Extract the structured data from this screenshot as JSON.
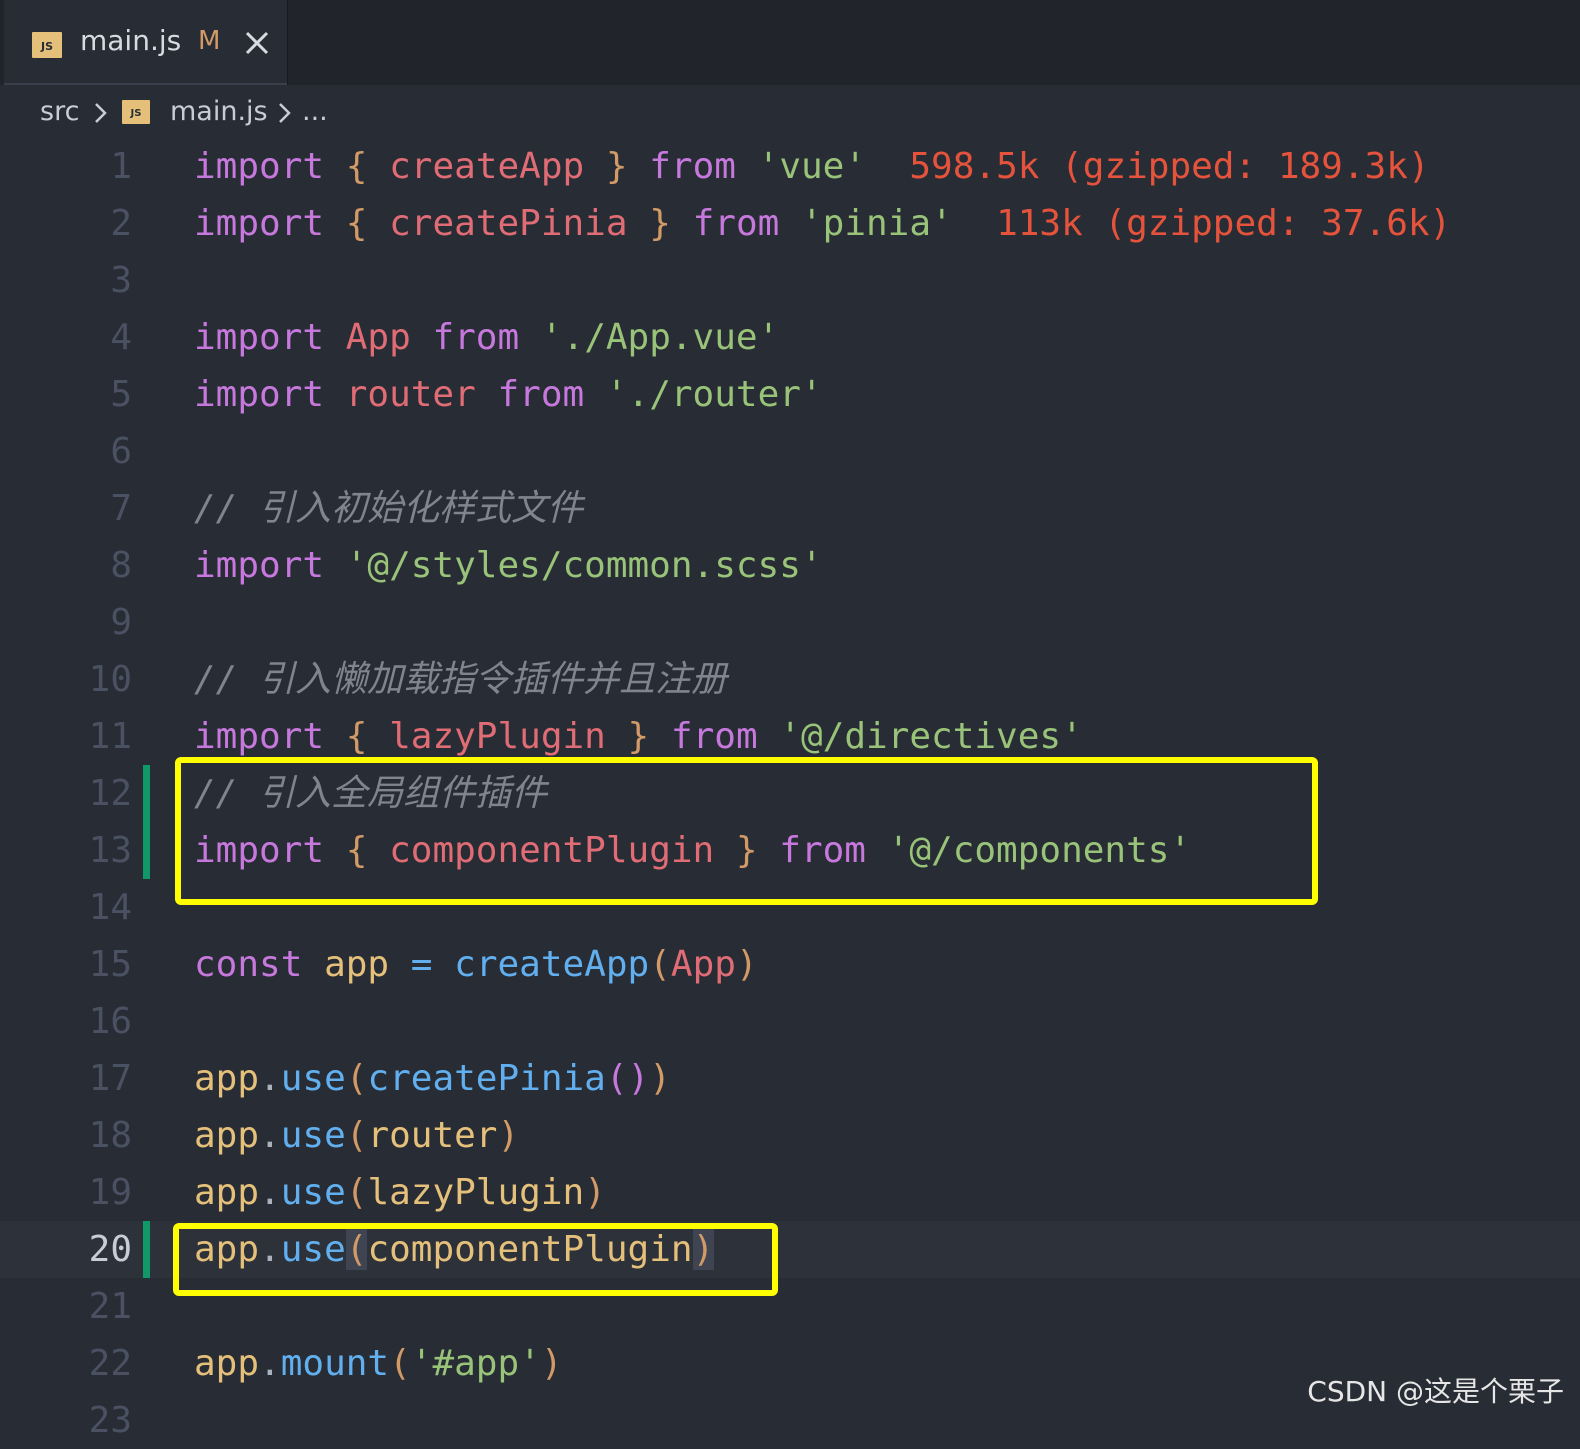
{
  "tab": {
    "icon_label": "JS",
    "filename": "main.js",
    "status": "M"
  },
  "breadcrumb": {
    "folder": "src",
    "file": "main.js",
    "more": "..."
  },
  "editor": {
    "current_line": 20,
    "lines": [
      {
        "num": "1",
        "tokens": [
          [
            "import",
            "kw"
          ],
          [
            " ",
            ""
          ],
          [
            "{",
            "brace"
          ],
          [
            " ",
            ""
          ],
          [
            "createApp",
            "var"
          ],
          [
            " ",
            ""
          ],
          [
            "}",
            "brace"
          ],
          [
            " ",
            ""
          ],
          [
            "from",
            "kw"
          ],
          [
            " ",
            ""
          ],
          [
            "'vue'",
            "str"
          ],
          [
            "  ",
            ""
          ],
          [
            "598.5k (gzipped: 189.3k)",
            "size"
          ]
        ]
      },
      {
        "num": "2",
        "tokens": [
          [
            "import",
            "kw"
          ],
          [
            " ",
            ""
          ],
          [
            "{",
            "brace"
          ],
          [
            " ",
            ""
          ],
          [
            "createPinia",
            "var"
          ],
          [
            " ",
            ""
          ],
          [
            "}",
            "brace"
          ],
          [
            " ",
            ""
          ],
          [
            "from",
            "kw"
          ],
          [
            " ",
            ""
          ],
          [
            "'pinia'",
            "str"
          ],
          [
            "  ",
            ""
          ],
          [
            "113k (gzipped: 37.6k)",
            "size"
          ]
        ]
      },
      {
        "num": "3",
        "tokens": []
      },
      {
        "num": "4",
        "tokens": [
          [
            "import",
            "kw"
          ],
          [
            " ",
            ""
          ],
          [
            "App",
            "var"
          ],
          [
            " ",
            ""
          ],
          [
            "from",
            "kw"
          ],
          [
            " ",
            ""
          ],
          [
            "'./App.vue'",
            "str"
          ]
        ]
      },
      {
        "num": "5",
        "tokens": [
          [
            "import",
            "kw"
          ],
          [
            " ",
            ""
          ],
          [
            "router",
            "var"
          ],
          [
            " ",
            ""
          ],
          [
            "from",
            "kw"
          ],
          [
            " ",
            ""
          ],
          [
            "'./router'",
            "str"
          ]
        ]
      },
      {
        "num": "6",
        "tokens": []
      },
      {
        "num": "7",
        "tokens": [
          [
            "// 引入初始化样式文件",
            "cmt"
          ]
        ]
      },
      {
        "num": "8",
        "tokens": [
          [
            "import",
            "kw"
          ],
          [
            " ",
            ""
          ],
          [
            "'@/styles/common.scss'",
            "str"
          ]
        ]
      },
      {
        "num": "9",
        "tokens": []
      },
      {
        "num": "10",
        "tokens": [
          [
            "// 引入懒加载指令插件并且注册",
            "cmt"
          ]
        ]
      },
      {
        "num": "11",
        "tokens": [
          [
            "import",
            "kw"
          ],
          [
            " ",
            ""
          ],
          [
            "{",
            "brace"
          ],
          [
            " ",
            ""
          ],
          [
            "lazyPlugin",
            "var"
          ],
          [
            " ",
            ""
          ],
          [
            "}",
            "brace"
          ],
          [
            " ",
            ""
          ],
          [
            "from",
            "kw"
          ],
          [
            " ",
            ""
          ],
          [
            "'@/directives'",
            "str"
          ]
        ]
      },
      {
        "num": "12",
        "git": true,
        "tokens": [
          [
            "// 引入全局组件插件",
            "cmt"
          ]
        ]
      },
      {
        "num": "13",
        "git": true,
        "tokens": [
          [
            "import",
            "kw"
          ],
          [
            " ",
            ""
          ],
          [
            "{",
            "brace"
          ],
          [
            " ",
            ""
          ],
          [
            "componentPlugin",
            "var"
          ],
          [
            " ",
            ""
          ],
          [
            "}",
            "brace"
          ],
          [
            " ",
            ""
          ],
          [
            "from",
            "kw"
          ],
          [
            " ",
            ""
          ],
          [
            "'@/components'",
            "str"
          ]
        ]
      },
      {
        "num": "14",
        "tokens": []
      },
      {
        "num": "15",
        "tokens": [
          [
            "const",
            "kw"
          ],
          [
            " ",
            ""
          ],
          [
            "app",
            "prop"
          ],
          [
            " ",
            ""
          ],
          [
            "=",
            "fn"
          ],
          [
            " ",
            ""
          ],
          [
            "createApp",
            "fn"
          ],
          [
            "(",
            "brace"
          ],
          [
            "App",
            "var"
          ],
          [
            ")",
            "brace"
          ]
        ]
      },
      {
        "num": "16",
        "tokens": []
      },
      {
        "num": "17",
        "tokens": [
          [
            "app",
            "prop"
          ],
          [
            ".",
            "punc"
          ],
          [
            "use",
            "fn"
          ],
          [
            "(",
            "brace"
          ],
          [
            "createPinia",
            "fn"
          ],
          [
            "()",
            "kw"
          ],
          [
            ")",
            "brace"
          ]
        ]
      },
      {
        "num": "18",
        "tokens": [
          [
            "app",
            "prop"
          ],
          [
            ".",
            "punc"
          ],
          [
            "use",
            "fn"
          ],
          [
            "(",
            "brace"
          ],
          [
            "router",
            "prop"
          ],
          [
            ")",
            "brace"
          ]
        ]
      },
      {
        "num": "19",
        "tokens": [
          [
            "app",
            "prop"
          ],
          [
            ".",
            "punc"
          ],
          [
            "use",
            "fn"
          ],
          [
            "(",
            "brace"
          ],
          [
            "lazyPlugin",
            "prop"
          ],
          [
            ")",
            "brace"
          ]
        ]
      },
      {
        "num": "20",
        "git": true,
        "current": true,
        "tokens": [
          [
            "app",
            "prop"
          ],
          [
            ".",
            "punc"
          ],
          [
            "use",
            "fn"
          ],
          [
            "(",
            "brace hlp"
          ],
          [
            "componentPlugin",
            "prop"
          ],
          [
            ")",
            "brace hlp"
          ]
        ]
      },
      {
        "num": "21",
        "tokens": []
      },
      {
        "num": "22",
        "tokens": [
          [
            "app",
            "prop"
          ],
          [
            ".",
            "punc"
          ],
          [
            "mount",
            "fn"
          ],
          [
            "(",
            "brace"
          ],
          [
            "'#app'",
            "str"
          ],
          [
            ")",
            "brace"
          ]
        ]
      },
      {
        "num": "23",
        "tokens": []
      }
    ]
  },
  "highlights": [
    "lines 12-13",
    "line 20"
  ],
  "colors": {
    "background": "#282c34",
    "keyword": "#c678dd",
    "string": "#98c379",
    "variable": "#e06c75",
    "function": "#61afef",
    "highlight_box": "#ffff00",
    "git_added": "#109868"
  },
  "watermark": "CSDN @这是个栗子"
}
